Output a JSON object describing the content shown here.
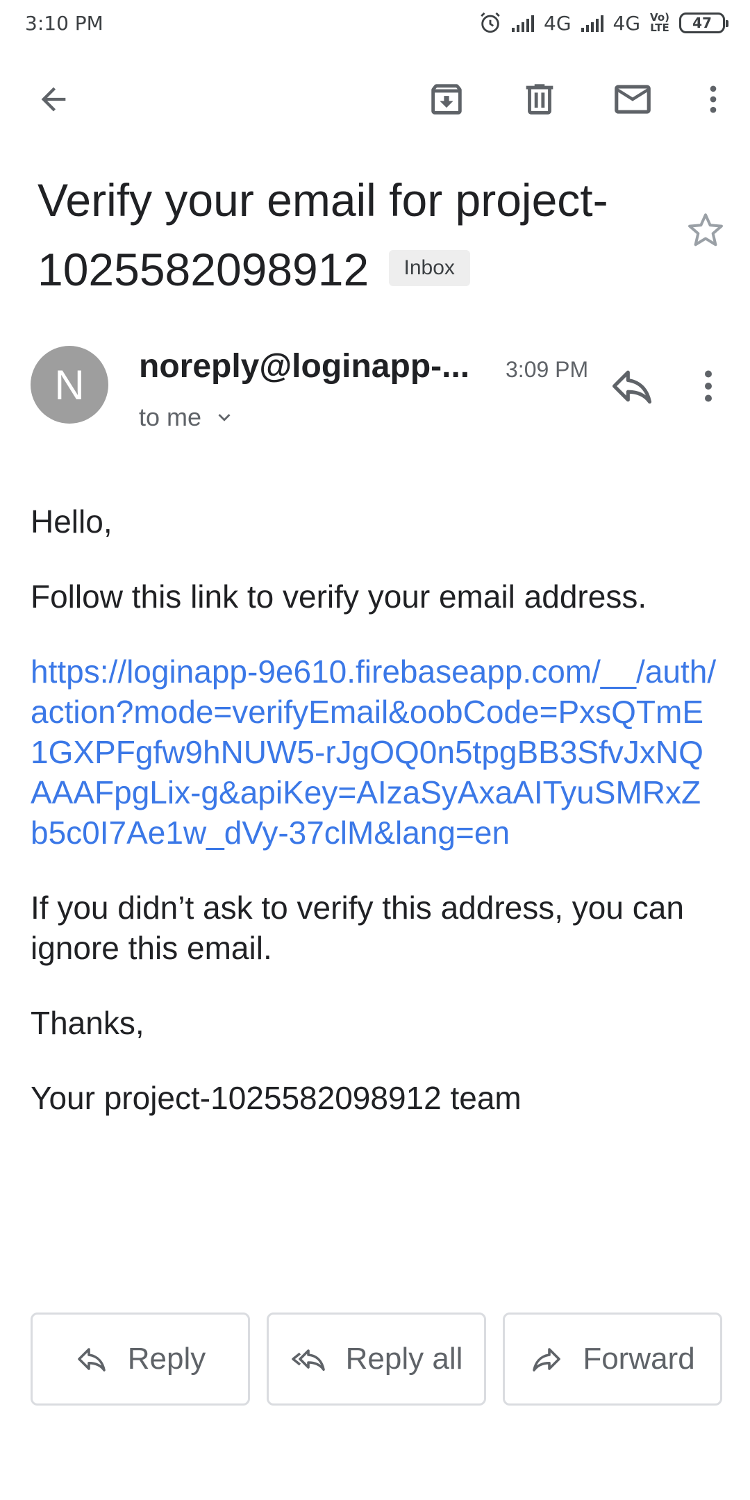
{
  "status_bar": {
    "time": "3:10 PM",
    "network1": "4G",
    "network2": "4G",
    "volte_top": "Vo)",
    "volte_bottom": "LTE",
    "battery": "47"
  },
  "toolbar": {
    "back_icon": "arrow-left-icon",
    "archive_icon": "archive-icon",
    "delete_icon": "trash-icon",
    "mark_unread_icon": "mail-icon",
    "more_icon": "more-vert-icon"
  },
  "email": {
    "subject": "Verify your email for project-1025582098912",
    "label": "Inbox",
    "avatar_letter": "N",
    "sender": "noreply@loginapp-...",
    "time": "3:09 PM",
    "recipient": "to me",
    "body": {
      "greeting": "Hello,",
      "instruction": "Follow this link to verify your email address.",
      "link": "https://loginapp-9e610.firebaseapp.com/__/auth/action?mode=verifyEmail&oobCode=PxsQTmE1GXPFgfw9hNUW5-rJgOQ0n5tpgBB3SfvJxNQAAAFpgLix-g&apiKey=AIzaSyAxaAITyuSMRxZb5c0I7Ae1w_dVy-37clM&lang=en",
      "disclaimer": "If you didn’t ask to verify this address, you can ignore this email.",
      "thanks": "Thanks,",
      "signature": "Your project-1025582098912 team"
    }
  },
  "actions": {
    "reply": "Reply",
    "reply_all": "Reply all",
    "forward": "Forward"
  },
  "colors": {
    "link": "#3b78e7",
    "avatar": "#9e9e9e",
    "icon": "#5f6368"
  }
}
